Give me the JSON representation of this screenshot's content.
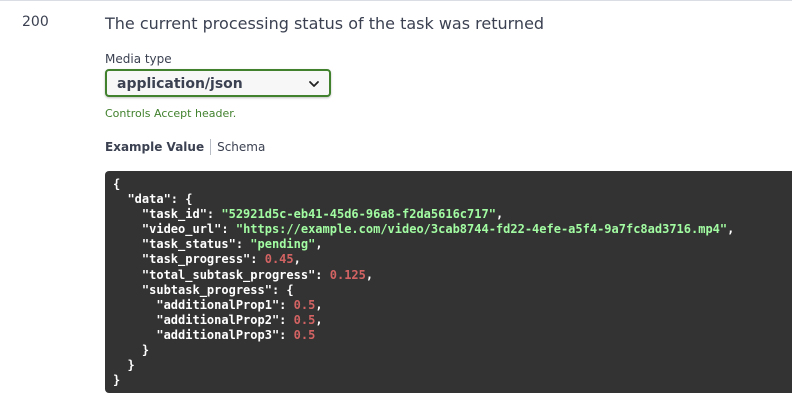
{
  "response": {
    "code": "200",
    "description": "The current processing status of the task was returned",
    "media_type_label": "Media type",
    "media_type_value": "application/json",
    "media_type_hint": "Controls Accept header.",
    "tabs": [
      "Example Value",
      "Schema"
    ],
    "active_tab": "Example Value"
  },
  "example": {
    "task_id": "52921d5c-eb41-45d6-96a8-f2da5616c717",
    "video_url": "https://example.com/video/3cab8744-fd22-4efe-a5f4-9a7fc8ad3716.mp4",
    "task_status": "pending",
    "task_progress": "0.45",
    "total_subtask_progress": "0.125",
    "additionalProp1": "0.5",
    "additionalProp2": "0.5",
    "additionalProp3": "0.5"
  },
  "colors": {
    "accent_green": "#41812d",
    "code_bg": "#333333",
    "string": "#a2fca2",
    "number": "#d36363"
  },
  "icons": {
    "select_chevron": "chevron-down-icon"
  }
}
